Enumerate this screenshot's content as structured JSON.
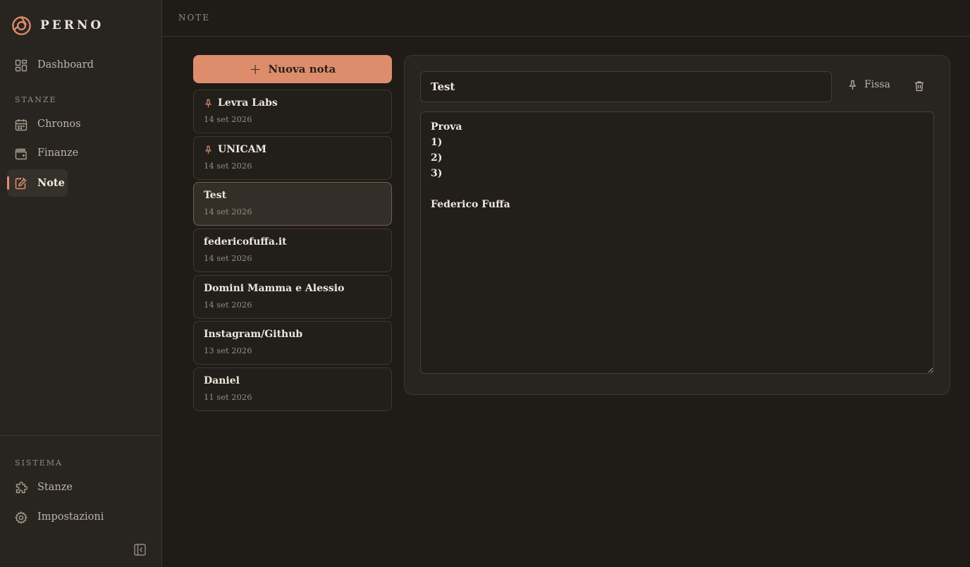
{
  "brand": {
    "name": "PERNO",
    "accent": "#de8d6c"
  },
  "sidebar": {
    "main_items": [
      {
        "label": "Dashboard",
        "icon": "dashboard-icon"
      }
    ],
    "rooms_section": "STANZE",
    "rooms": [
      {
        "label": "Chronos",
        "icon": "calendar-icon"
      },
      {
        "label": "Finanze",
        "icon": "wallet-icon"
      },
      {
        "label": "Note",
        "icon": "note-edit-icon",
        "active": true
      }
    ],
    "system_section": "SISTEMA",
    "system": [
      {
        "label": "Stanze",
        "icon": "puzzle-icon"
      },
      {
        "label": "Impostazioni",
        "icon": "gear-icon"
      }
    ]
  },
  "header": {
    "title": "NOTE"
  },
  "notes_list": {
    "new_note_label": "Nuova nota",
    "notes": [
      {
        "title": "Levra Labs",
        "date": "14 set 2026",
        "pinned": true
      },
      {
        "title": "UNICAM",
        "date": "14 set 2026",
        "pinned": true
      },
      {
        "title": "Test",
        "date": "14 set 2026",
        "selected": true
      },
      {
        "title": "federicofuffa.it",
        "date": "14 set 2026"
      },
      {
        "title": "Domini Mamma e Alessio",
        "date": "14 set 2026"
      },
      {
        "title": "Instagram/Github",
        "date": "13 set 2026"
      },
      {
        "title": "Daniel",
        "date": "11 set 2026"
      }
    ]
  },
  "editor": {
    "title_value": "Test",
    "pin_label": "Fissa",
    "body_value": "Prova\n1)\n2)\n3)\n\nFederico Fuffa"
  }
}
